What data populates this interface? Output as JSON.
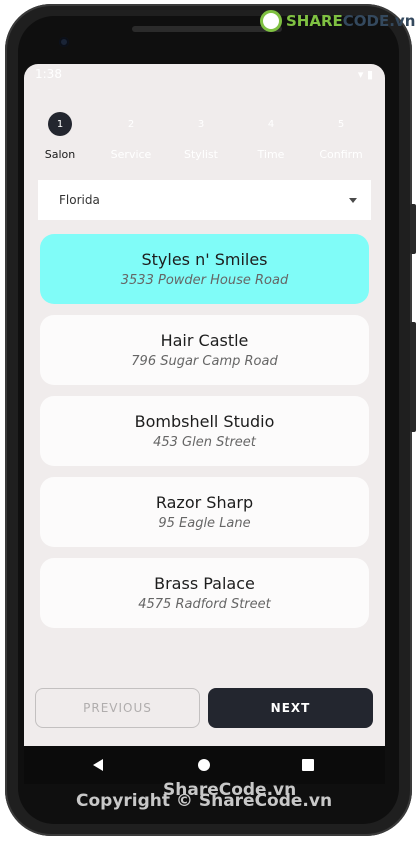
{
  "watermark": {
    "logo_brand": "SHARE",
    "logo_rest": "CODE.vn",
    "top": "ShareCode.vn",
    "bottom": "Copyright © ShareCode.vn"
  },
  "statusbar": {
    "time": "1:38",
    "right": "▾ ▮"
  },
  "stepper": {
    "steps": [
      {
        "number": "1",
        "label": "Salon"
      },
      {
        "number": "2",
        "label": "Service"
      },
      {
        "number": "3",
        "label": "Stylist"
      },
      {
        "number": "4",
        "label": "Time"
      },
      {
        "number": "5",
        "label": "Confirm"
      }
    ]
  },
  "location": {
    "selected": "Florida"
  },
  "salons": [
    {
      "name": "Styles n' Smiles",
      "address": "3533  Powder House Road"
    },
    {
      "name": "Hair Castle",
      "address": "796  Sugar Camp Road"
    },
    {
      "name": "Bombshell Studio",
      "address": "453  Glen Street"
    },
    {
      "name": "Razor Sharp",
      "address": "95  Eagle Lane"
    },
    {
      "name": "Brass Palace",
      "address": "4575  Radford Street"
    }
  ],
  "buttons": {
    "previous": "PREVIOUS",
    "next": "NEXT"
  },
  "colors": {
    "selected_card": "#80fcf8",
    "primary": "#23262f",
    "screen_bg": "#f0ecec"
  }
}
